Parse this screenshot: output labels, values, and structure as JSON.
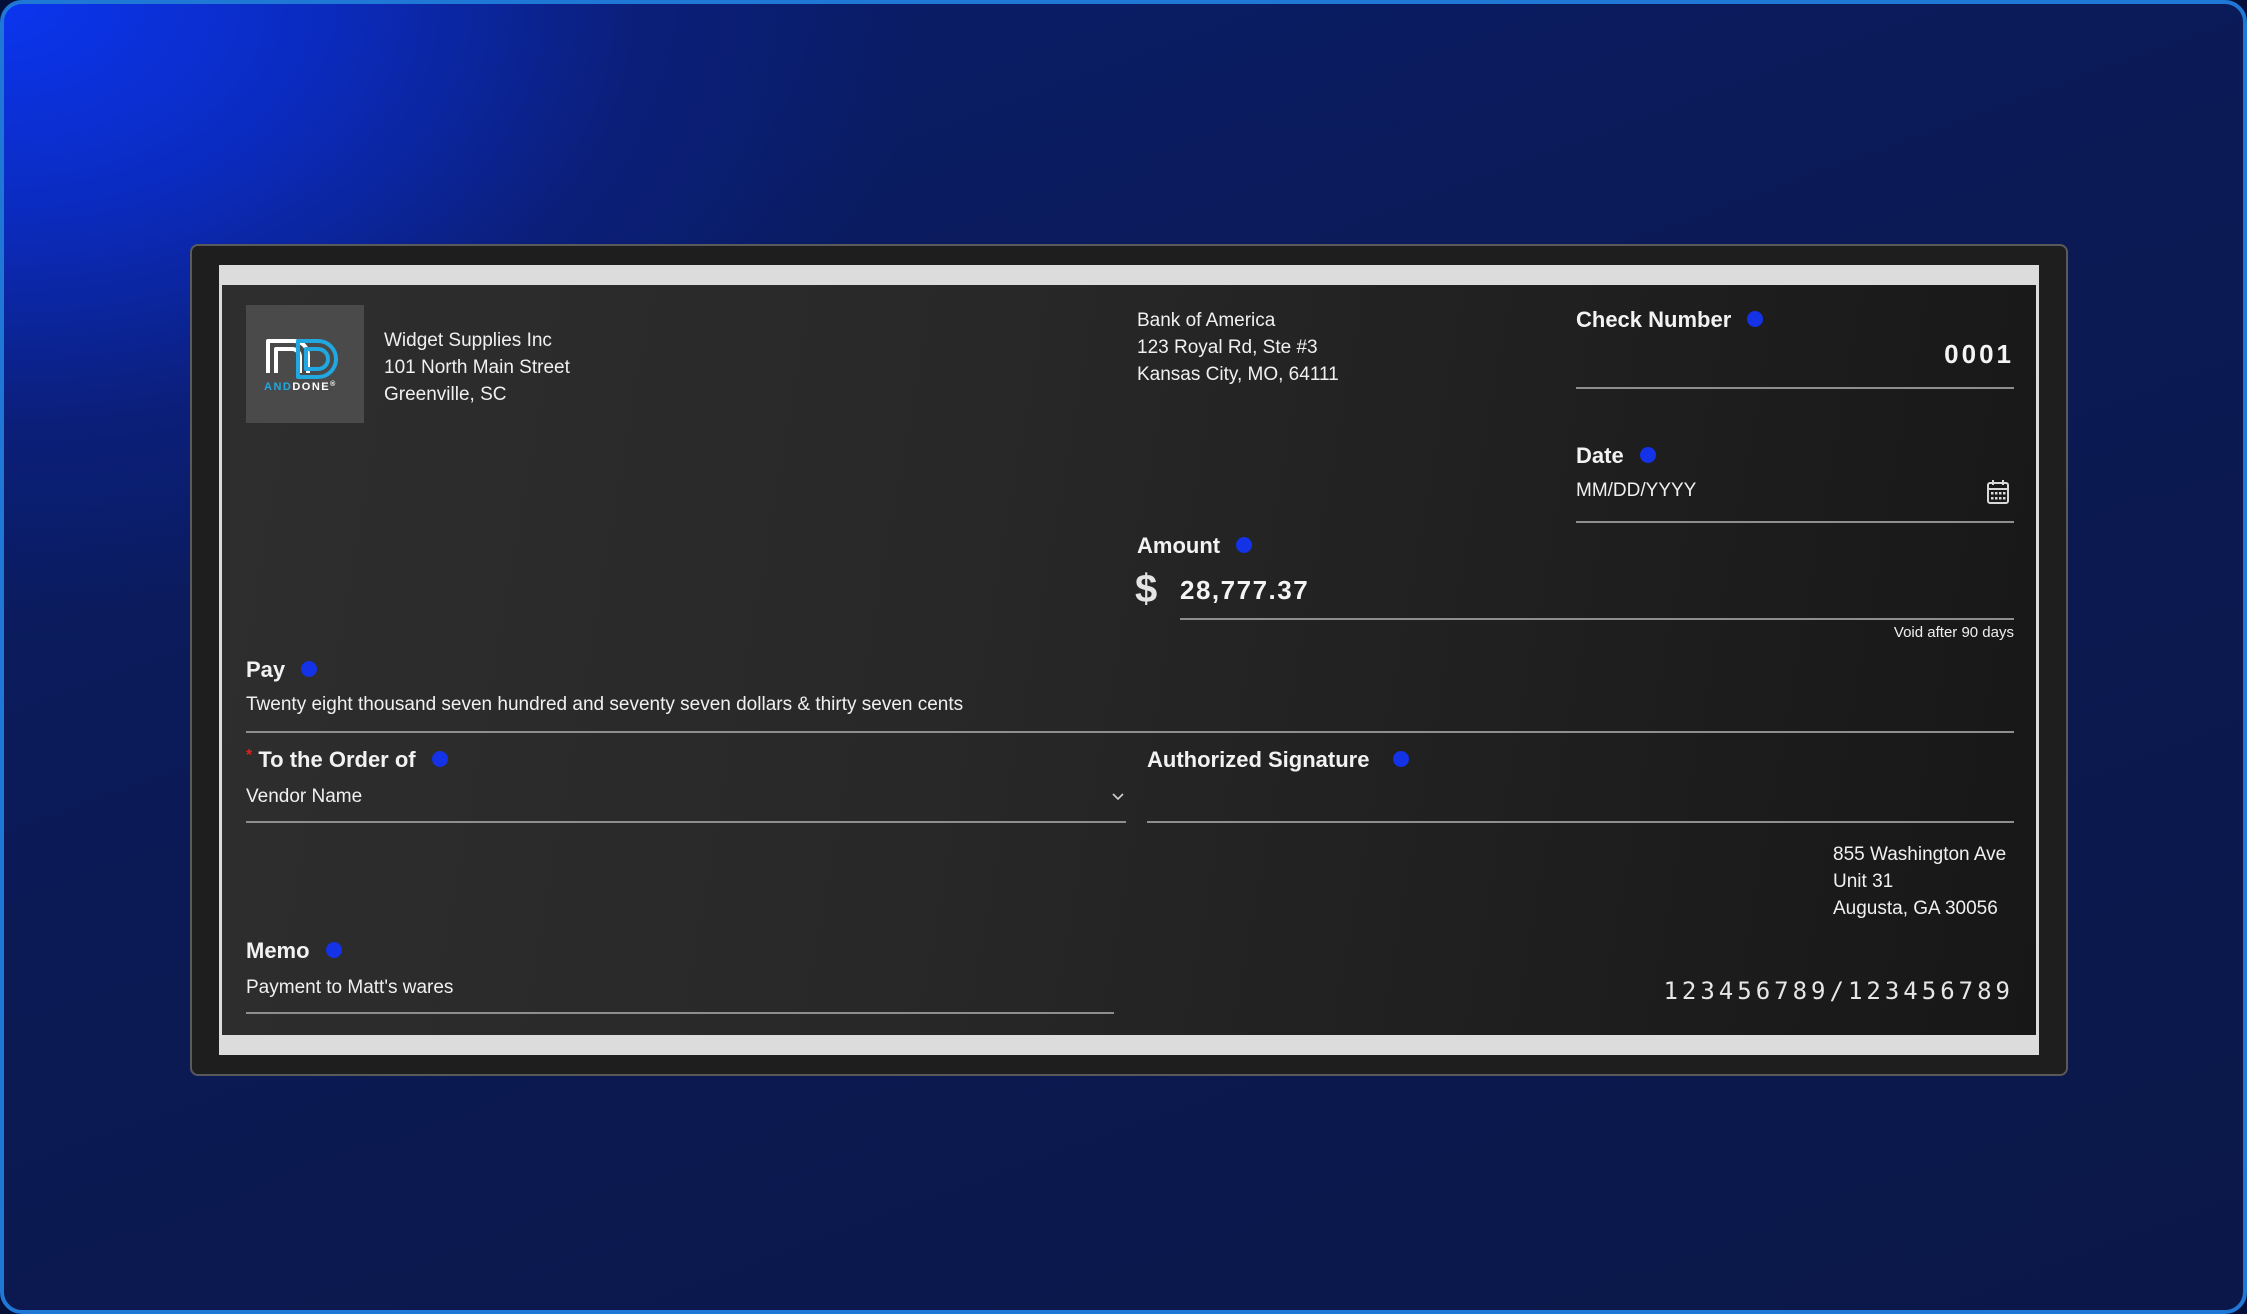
{
  "company": {
    "name": "Widget Supplies Inc",
    "street": "101 North Main Street",
    "city": "Greenville, SC"
  },
  "logo": {
    "text_and": "AND",
    "text_done": "DONE",
    "mark": "®"
  },
  "bank": {
    "name": "Bank of America",
    "street": "123 Royal Rd, Ste #3",
    "city": "Kansas City, MO, 64111"
  },
  "check_number": {
    "label": "Check Number",
    "value": "0001"
  },
  "date": {
    "label": "Date",
    "placeholder": "MM/DD/YYYY",
    "icon": "calendar-icon"
  },
  "amount": {
    "label": "Amount",
    "currency_symbol": "$",
    "value": "28,777.37",
    "void_note": "Void after 90 days"
  },
  "pay": {
    "label": "Pay",
    "value": "Twenty eight thousand seven hundred and seventy seven dollars & thirty seven cents"
  },
  "order": {
    "required_mark": "*",
    "label": "To the Order of",
    "value": "Vendor Name",
    "icon": "chevron-down-icon"
  },
  "signature": {
    "label": "Authorized Signature"
  },
  "payee_address": {
    "street": "855 Washington Ave",
    "unit": "Unit 31",
    "city": "Augusta, GA 30056"
  },
  "memo": {
    "label": "Memo",
    "value": "Payment to Matt's wares"
  },
  "micr": {
    "value": "123456789/123456789"
  },
  "colors": {
    "info_dot": "#1432e6",
    "required": "#e02020",
    "logo_blue": "#21a8e0"
  }
}
